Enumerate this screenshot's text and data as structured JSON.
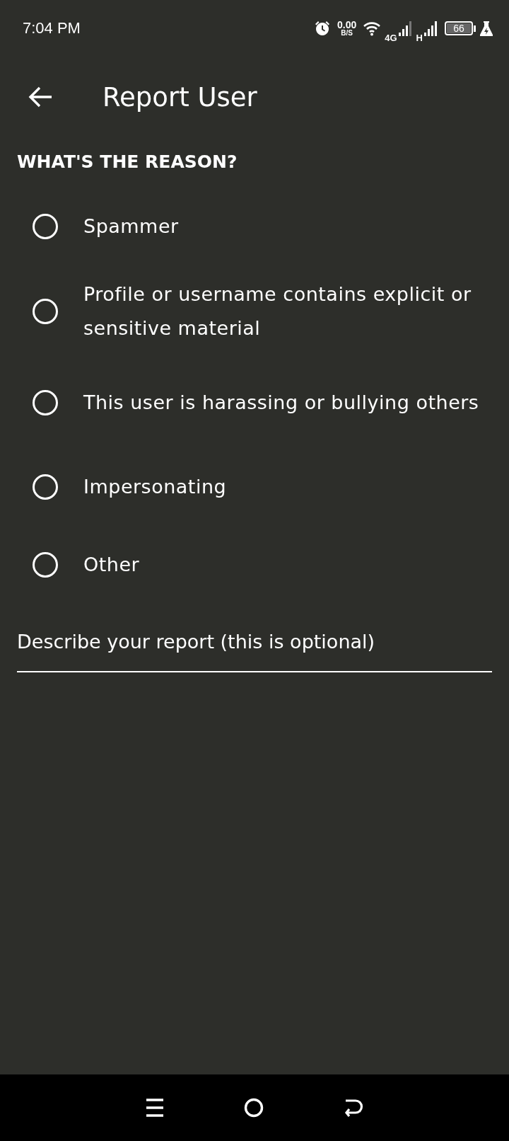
{
  "status_bar": {
    "time": "7:04 PM",
    "speed_value": "0.00",
    "speed_unit": "B/S",
    "network_1": "4G",
    "network_2": "H",
    "battery": "66"
  },
  "app_bar": {
    "title": "Report User"
  },
  "section_title": "WHAT'S THE REASON?",
  "reasons": [
    {
      "label": "Spammer",
      "selected": false
    },
    {
      "label": "Profile or username contains explicit or sensitive material",
      "selected": false
    },
    {
      "label": "This user is harassing or bullying others",
      "selected": false
    },
    {
      "label": "Impersonating",
      "selected": false
    },
    {
      "label": "Other",
      "selected": false
    }
  ],
  "description": {
    "placeholder": "Describe your report (this is optional)"
  }
}
